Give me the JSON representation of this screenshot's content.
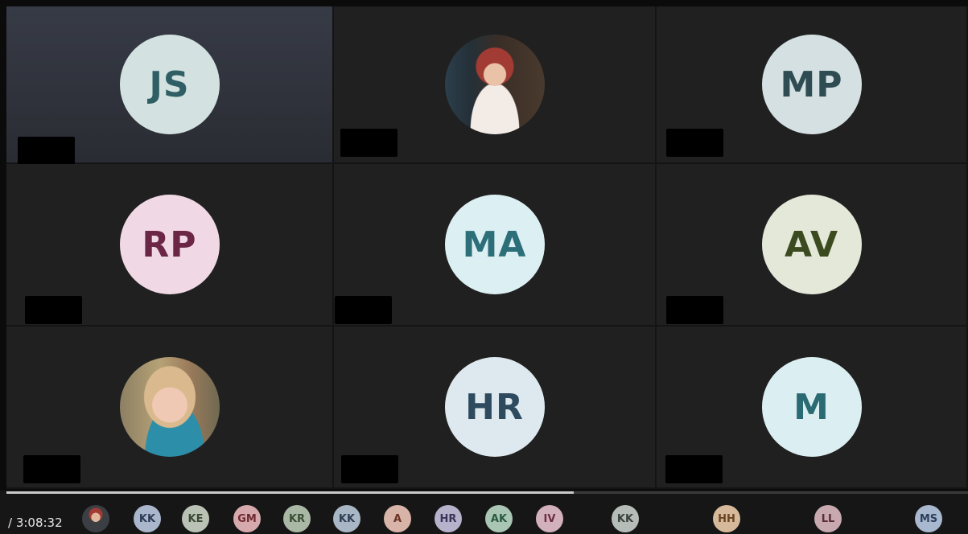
{
  "meeting": {
    "elapsed_time": "/ 3:08:32",
    "progress": 0.59
  },
  "tiles": [
    {
      "initials": "JS",
      "avatar_bg": "#d3e2e1",
      "initials_color": "#2f5f64",
      "photo": false,
      "active": true
    },
    {
      "initials": "",
      "avatar_bg": "",
      "initials_color": "",
      "photo": true,
      "active": false
    },
    {
      "initials": "MP",
      "avatar_bg": "#d4e0e2",
      "initials_color": "#2f4c52",
      "photo": false,
      "active": false
    },
    {
      "initials": "RP",
      "avatar_bg": "#f1d8e5",
      "initials_color": "#6b2645",
      "photo": false,
      "active": false
    },
    {
      "initials": "MA",
      "avatar_bg": "#dceff2",
      "initials_color": "#2c6f79",
      "photo": false,
      "active": false
    },
    {
      "initials": "AV",
      "avatar_bg": "#e3e8d9",
      "initials_color": "#3b4a1f",
      "photo": false,
      "active": false
    },
    {
      "initials": "",
      "avatar_bg": "",
      "initials_color": "",
      "photo": true,
      "active": false
    },
    {
      "initials": "HR",
      "avatar_bg": "#dde9ee",
      "initials_color": "#2d4a5e",
      "photo": false,
      "active": false
    },
    {
      "initials": "M",
      "avatar_bg": "#dbeef1",
      "initials_color": "#2a6a72",
      "photo": false,
      "active": false
    }
  ],
  "participant_strip": [
    {
      "initials": "",
      "photo": true,
      "bg": "",
      "fg": ""
    },
    {
      "initials": "KK",
      "photo": false,
      "bg": "#aab6cc",
      "fg": "#2e3c57"
    },
    {
      "initials": "KE",
      "photo": false,
      "bg": "#b9c2b4",
      "fg": "#3b4a37"
    },
    {
      "initials": "GM",
      "photo": false,
      "bg": "#d6a9ac",
      "fg": "#6e2a30"
    },
    {
      "initials": "KR",
      "photo": false,
      "bg": "#a9b8a4",
      "fg": "#3a4e36"
    },
    {
      "initials": "KK",
      "photo": false,
      "bg": "#a9b6c6",
      "fg": "#2f3f55"
    },
    {
      "initials": "A",
      "photo": false,
      "bg": "#d8b3a7",
      "fg": "#6b3326"
    },
    {
      "initials": "HR",
      "photo": false,
      "bg": "#b6b2cc",
      "fg": "#3a365a"
    },
    {
      "initials": "AK",
      "photo": false,
      "bg": "#a9c6b4",
      "fg": "#2a5a40"
    },
    {
      "initials": "IV",
      "photo": false,
      "bg": "#d2b1bc",
      "fg": "#6a2f44"
    },
    {
      "initials": "KK",
      "photo": false,
      "bg": "#b6bdb8",
      "fg": "#3a423d"
    },
    {
      "initials": "HH",
      "photo": false,
      "bg": "#d6b99a",
      "fg": "#6a4523"
    },
    {
      "initials": "LL",
      "photo": false,
      "bg": "#c8a9b0",
      "fg": "#5a2d38"
    },
    {
      "initials": "MS",
      "photo": false,
      "bg": "#a8b8cf",
      "fg": "#2c3f5a"
    }
  ]
}
